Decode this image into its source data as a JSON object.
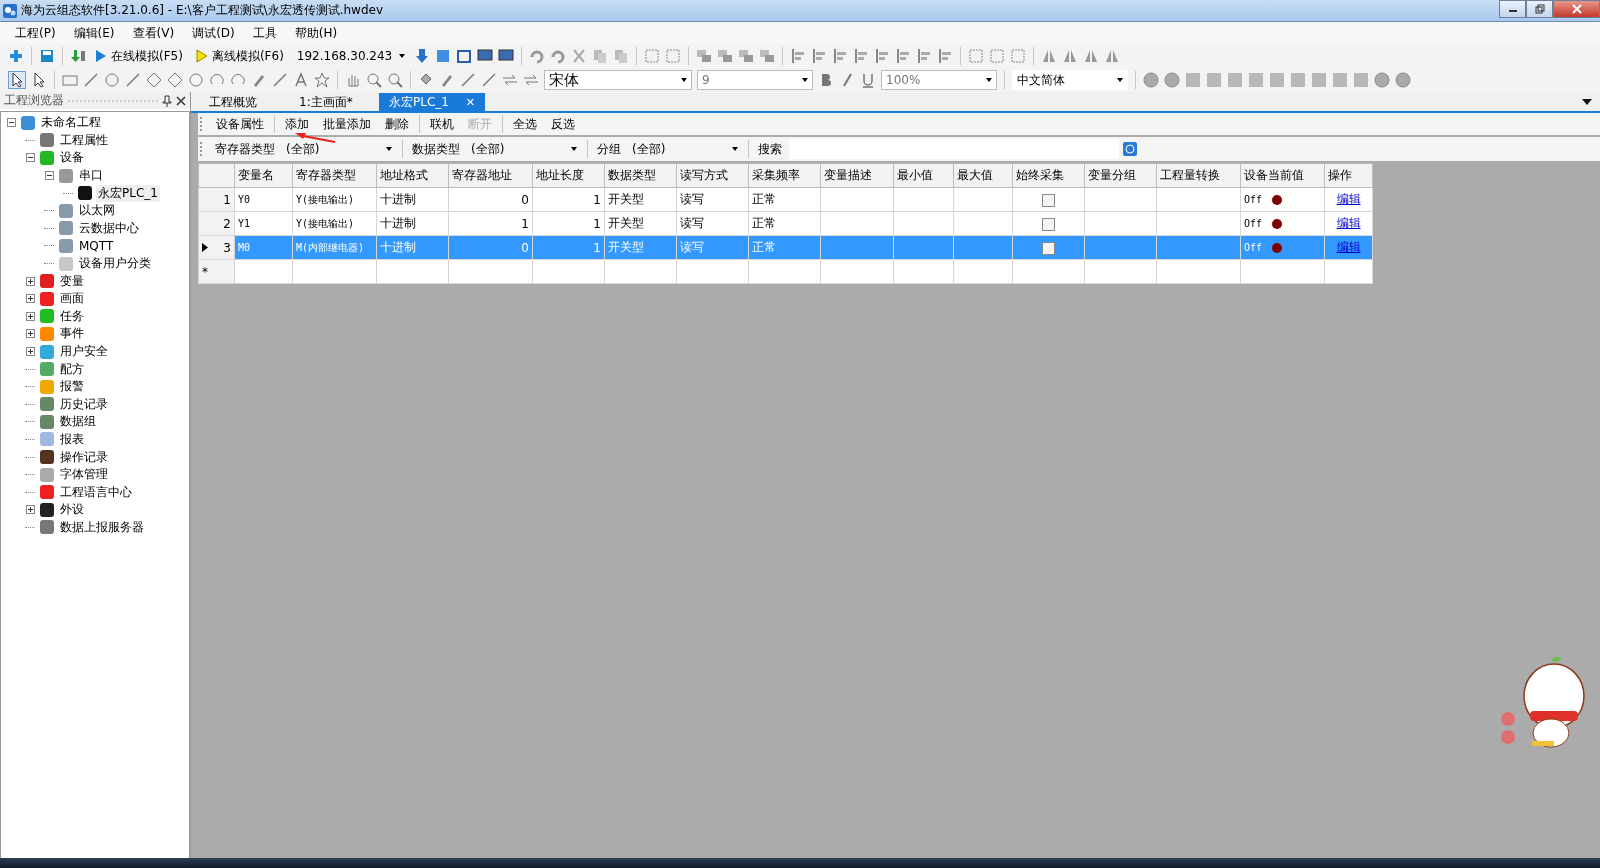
{
  "window": {
    "title": "海为云组态软件[3.21.0.6] - E:\\客户工程测试\\永宏透传测试.hwdev"
  },
  "menu": [
    "工程(P)",
    "编辑(E)",
    "查看(V)",
    "调试(D)",
    "工具",
    "帮助(H)"
  ],
  "toolbar": {
    "online": "在线模拟(F5)",
    "offline": "离线模拟(F6)",
    "ip": "192.168.30.243"
  },
  "format_bar": {
    "font": "宋体",
    "size": "9",
    "zoom": "100%",
    "language": "中文简体"
  },
  "explorer": {
    "title": "工程浏览器",
    "tree": [
      {
        "label": "未命名工程",
        "expanded": true,
        "selected": false,
        "children": [
          {
            "label": "工程属性",
            "selected": false
          },
          {
            "label": "设备",
            "expanded": true,
            "selected": false,
            "children": [
              {
                "label": "串口",
                "expanded": true,
                "selected": false,
                "children": [
                  {
                    "label": "永宏PLC_1",
                    "selected": true
                  }
                ]
              },
              {
                "label": "以太网",
                "selected": false
              },
              {
                "label": "云数据中心",
                "selected": false
              },
              {
                "label": "MQTT",
                "selected": false
              },
              {
                "label": "设备用户分类",
                "selected": false
              }
            ]
          },
          {
            "label": "变量",
            "expanded": false,
            "selected": false
          },
          {
            "label": "画面",
            "expanded": false,
            "selected": false
          },
          {
            "label": "任务",
            "expanded": false,
            "selected": false
          },
          {
            "label": "事件",
            "expanded": false,
            "selected": false
          },
          {
            "label": "用户安全",
            "expanded": false,
            "selected": false
          },
          {
            "label": "配方",
            "selected": false
          },
          {
            "label": "报警",
            "selected": false
          },
          {
            "label": "历史记录",
            "selected": false
          },
          {
            "label": "数据组",
            "selected": false
          },
          {
            "label": "报表",
            "selected": false
          },
          {
            "label": "操作记录",
            "selected": false
          },
          {
            "label": "字体管理",
            "selected": false
          },
          {
            "label": "工程语言中心",
            "selected": false
          },
          {
            "label": "外设",
            "expanded": false,
            "selected": false
          },
          {
            "label": "数据上报服务器",
            "selected": false
          }
        ]
      }
    ]
  },
  "tabs": [
    {
      "label": "工程概览",
      "selected": false
    },
    {
      "label": "1:主画面*",
      "selected": false
    },
    {
      "label": "永宏PLC_1",
      "selected": true,
      "close": "✕"
    }
  ],
  "device_toolbar": [
    {
      "label": "设备属性",
      "disabled": false
    },
    {
      "label": "添加",
      "disabled": false
    },
    {
      "label": "批量添加",
      "disabled": false
    },
    {
      "label": "删除",
      "disabled": false
    },
    {
      "label": "联机",
      "disabled": false
    },
    {
      "label": "断开",
      "disabled": true
    },
    {
      "label": "全选",
      "disabled": false
    },
    {
      "label": "反选",
      "disabled": false
    }
  ],
  "filters": [
    {
      "label": "寄存器类型",
      "value": "(全部)"
    },
    {
      "label": "数据类型",
      "value": "(全部)"
    },
    {
      "label": "分组",
      "value": "(全部)"
    }
  ],
  "search": {
    "label": "搜索"
  },
  "table": {
    "columns": [
      "变量名",
      "寄存器类型",
      "地址格式",
      "寄存器地址",
      "地址长度",
      "数据类型",
      "读写方式",
      "采集频率",
      "变量描述",
      "最小值",
      "最大值",
      "始终采集",
      "变量分组",
      "工程量转换",
      "设备当前值",
      "操作"
    ],
    "rows": [
      {
        "index": "1",
        "selected": false,
        "name": "Y0",
        "register": "Y(接电输出)",
        "format": "十进制",
        "address": "0",
        "length": "1",
        "data_type": "开关型",
        "access": "读写",
        "rate": "正常",
        "always": false,
        "value": "Off",
        "color": "#800000",
        "action": "编辑"
      },
      {
        "index": "2",
        "selected": false,
        "name": "Y1",
        "register": "Y(接电输出)",
        "format": "十进制",
        "address": "1",
        "length": "1",
        "data_type": "开关型",
        "access": "读写",
        "rate": "正常",
        "always": false,
        "value": "Off",
        "color": "#800000",
        "action": "编辑"
      },
      {
        "index": "3",
        "selected": true,
        "name": "M0",
        "register": "M(内部继电器)",
        "format": "十进制",
        "address": "0",
        "length": "1",
        "data_type": "开关型",
        "access": "读写",
        "rate": "正常",
        "always": false,
        "value": "Off",
        "color": "#800000",
        "action": "编辑"
      }
    ],
    "new_row": "*"
  }
}
